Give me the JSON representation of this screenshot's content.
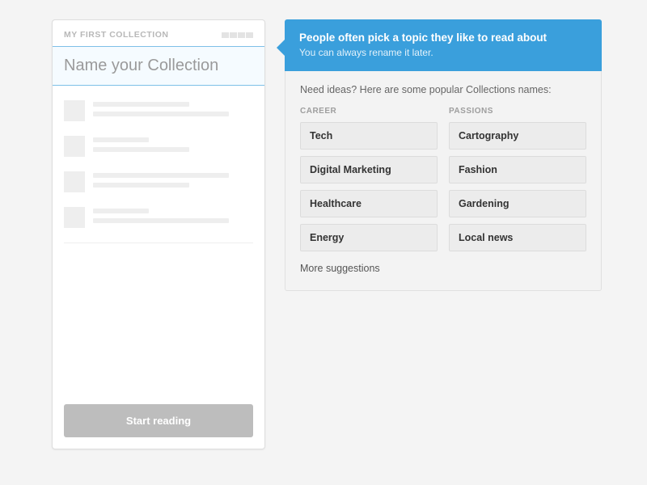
{
  "panel": {
    "title": "MY FIRST COLLECTION",
    "input_placeholder": "Name your Collection",
    "start_button": "Start reading"
  },
  "callout": {
    "title": "People often pick a topic they like to read about",
    "subtitle": "You can always rename it later.",
    "intro": "Need ideas? Here are some popular Collections names:",
    "columns": {
      "career": {
        "label": "CAREER",
        "items": [
          "Tech",
          "Digital Marketing",
          "Healthcare",
          "Energy"
        ]
      },
      "passions": {
        "label": "PASSIONS",
        "items": [
          "Cartography",
          "Fashion",
          "Gardening",
          "Local news"
        ]
      }
    },
    "more": "More suggestions"
  }
}
